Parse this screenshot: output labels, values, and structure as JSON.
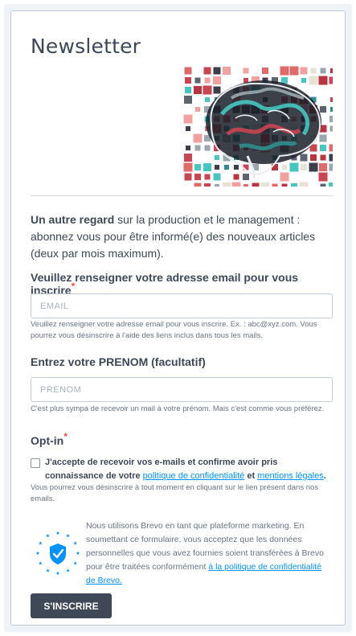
{
  "form": {
    "title": "Newsletter",
    "intro_bold": "Un autre regard",
    "intro_rest": " sur la production et le management : abonnez vous pour être informé(e) des nouveaux articles (deux par mois maximum).",
    "email": {
      "label": "Veuillez renseigner votre adresse email pour vous inscrire",
      "required_mark": "*",
      "placeholder": "EMAIL",
      "value": "",
      "help": "Veuillez renseigner votre adresse email pour vous inscrire. Ex. : abc@xyz.com. Vous pourrez vous désinscrire à l'aide des liens inclus dans tous les mails."
    },
    "prenom": {
      "label": "Entrez votre PRENOM (facultatif)",
      "placeholder": "PRENOM",
      "value": "",
      "help": "C'est plus sympa de recevoir un mail à votre prénom. Mais c'est comme vous préférez."
    },
    "optin": {
      "label": "Opt-in",
      "required_mark": "*",
      "checked": false,
      "text_before": "J'accepte de recevoir vos e-mails et confirme avoir pris connaissance de votre ",
      "privacy_link": "politique de confidentialité",
      "text_middle": " et ",
      "legal_link": "mentions légales",
      "text_after": ".",
      "help": "Vous pourrez vous désinscrire à tout moment en cliquant sur le lien présent dans nos emails."
    },
    "brevo": {
      "text": "Nous utilisons Brevo en tant que plateforme marketing. En soumettant ce formulaire, vous acceptez que les données personnelles que vous avez fournies soient transférées à Brevo pour être traitées conformément ",
      "link": "à la politique de confidentialité de Brevo."
    },
    "submit_label": "S'INSCRIRE"
  },
  "colors": {
    "accent_link": "#0092ff",
    "button_bg": "#3e4857",
    "required": "#ff4949",
    "text": "#3c4858",
    "eu_blue": "#0092ff"
  },
  "icons": {
    "header_image": "brain-mosaic-illustration",
    "badge": "shield-check-icon"
  }
}
